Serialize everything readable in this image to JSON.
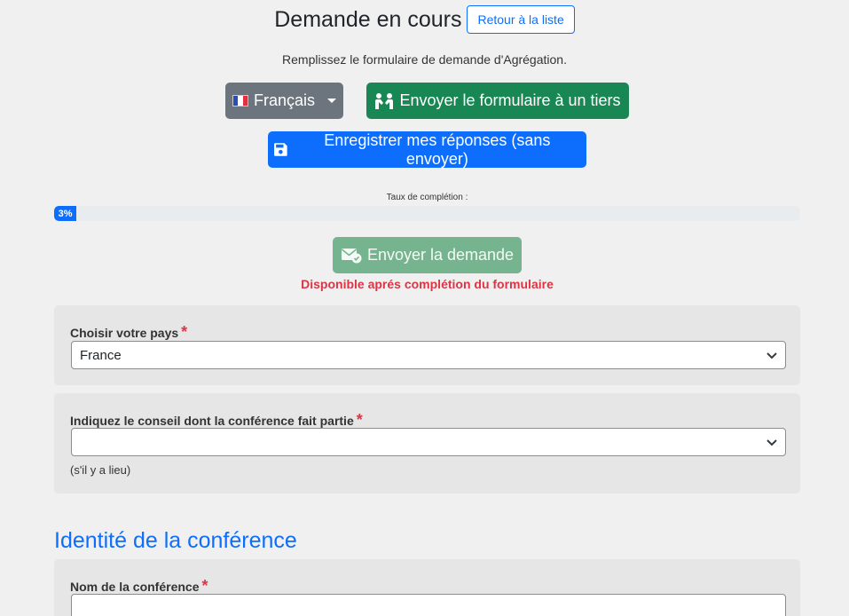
{
  "header": {
    "title": "Demande en cours",
    "back_label": "Retour à la liste"
  },
  "intro": "Remplissez le formulaire de demande d'Agrégation.",
  "actions": {
    "language_label": "Français",
    "send_third_party_label": "Envoyer le formulaire à un tiers",
    "save_label": "Enregistrer mes réponses (sans envoyer)"
  },
  "progress": {
    "label": "Taux de complétion :",
    "value_text": "3%",
    "percent": 3
  },
  "submit": {
    "label": "Envoyer la demande",
    "notice": "Disponible aprés complétion du formulaire"
  },
  "country": {
    "label": "Choisir votre pays",
    "required_mark": "*",
    "value": "France"
  },
  "council": {
    "label": "Indiquez le conseil dont la conférence fait partie",
    "required_mark": "*",
    "value": "",
    "hint": "(s'il y a lieu)"
  },
  "identity": {
    "section_title": "Identité de la conférence",
    "name_label": "Nom de la conférence",
    "required_mark": "*"
  },
  "colors": {
    "primary": "#0d6efd",
    "success": "#198754",
    "secondary": "#6c757d",
    "danger": "#dc3545",
    "background": "#f0f0f0"
  }
}
